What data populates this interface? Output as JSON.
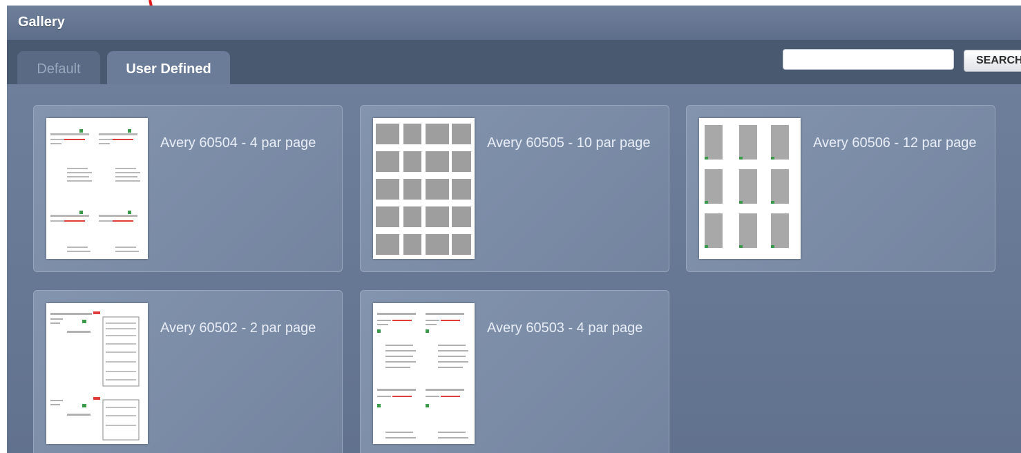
{
  "window": {
    "title": "Gallery"
  },
  "tabs": [
    {
      "label": "Default",
      "active": false
    },
    {
      "label": "User Defined",
      "active": true
    }
  ],
  "search": {
    "placeholder": "",
    "button_label": "SEARCH"
  },
  "templates": [
    {
      "label": "Avery 60504 - 4 par page",
      "layout": "4-up"
    },
    {
      "label": "Avery 60505 - 10 par page",
      "layout": "10-up"
    },
    {
      "label": "Avery 60506 - 12 par page",
      "layout": "12-up"
    },
    {
      "label": "Avery 60502 - 2 par page",
      "layout": "2-up"
    },
    {
      "label": "Avery 60503 - 4 par page",
      "layout": "4-up"
    }
  ],
  "colors": {
    "titlebar": "#65768f",
    "tab_active": "#6b7c98",
    "annotation_arrow": "#e21a1a"
  }
}
